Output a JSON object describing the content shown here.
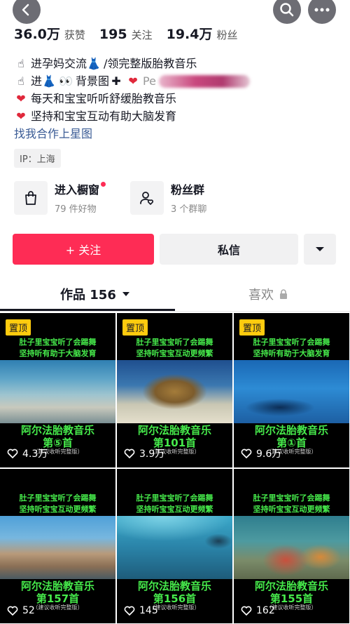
{
  "stats": [
    {
      "value": "36.0万",
      "label": "获赞"
    },
    {
      "value": "195",
      "label": "关注"
    },
    {
      "value": "19.4万",
      "label": "粉丝"
    }
  ],
  "bio": {
    "line1_text": "进孕妈交流",
    "line1_text2": "/领完整版胎教音乐",
    "line2_text1": "进",
    "line2_text2": "背景图",
    "line2_text3": "Pe",
    "line3_text": "每天和宝宝听听舒缓胎教音乐",
    "line4_text": "坚持和宝宝互动有助大脑发育",
    "link": "找我合作上星图"
  },
  "ip_tag": "IP：上海",
  "entries": [
    {
      "title": "进入橱窗",
      "sub": "79 件好物"
    },
    {
      "title": "粉丝群",
      "sub": "3 个群聊"
    }
  ],
  "actions": {
    "follow": "+ 关注",
    "message": "私信"
  },
  "tabs": {
    "works": "作品 156",
    "likes": "喜欢"
  },
  "videos": [
    {
      "pinned": "置顶",
      "cap1": "肚子里宝宝听了会踢舞",
      "cap2": "坚持听有助于大脑发育",
      "title1": "阿尔法胎教音乐",
      "title2": "第⑤首",
      "note": "（建议收听完整版）",
      "likes": "4.3万"
    },
    {
      "pinned": "置顶",
      "cap1": "肚子里宝宝听了会踢舞",
      "cap2": "坚持听宝宝互动更频繁",
      "title1": "阿尔法胎教音乐",
      "title2": "第101首",
      "note": "（建议收听完整版）",
      "likes": "3.9万"
    },
    {
      "pinned": "置顶",
      "cap1": "肚子里宝宝听了会踢舞",
      "cap2": "坚持听有助于大脑发育",
      "title1": "阿尔法胎教音乐",
      "title2": "第①首",
      "note": "（建议收听完整版）",
      "likes": "9.6万"
    },
    {
      "pinned": "",
      "cap1": "肚子里宝宝听了会踢舞",
      "cap2": "坚持听宝宝互动更频繁",
      "title1": "阿尔法胎教音乐",
      "title2": "第157首",
      "note": "（建议收听完整版）",
      "likes": "52"
    },
    {
      "pinned": "",
      "cap1": "肚子里宝宝听了会踢舞",
      "cap2": "坚持听宝宝互动更频繁",
      "title1": "阿尔法胎教音乐",
      "title2": "第156首",
      "note": "（建议收听完整版）",
      "likes": "145"
    },
    {
      "pinned": "",
      "cap1": "肚子里宝宝听了会踢舞",
      "cap2": "坚持听宝宝互动更频繁",
      "title1": "阿尔法胎教音乐",
      "title2": "第155首",
      "note": "（建议收听完整版）",
      "likes": "162"
    }
  ],
  "icons": {
    "back": "back-arrow-icon",
    "search": "search-icon",
    "more": "more-icon",
    "shop": "shopping-bag-icon",
    "fans": "fans-group-icon",
    "dropdown": "chevron-down-icon",
    "lock": "lock-icon",
    "heart": "heart-icon"
  },
  "colors": {
    "accent": "#fe2c55",
    "pin": "#fecb0e",
    "caption": "#46ea4b",
    "link": "#3a5b95"
  }
}
